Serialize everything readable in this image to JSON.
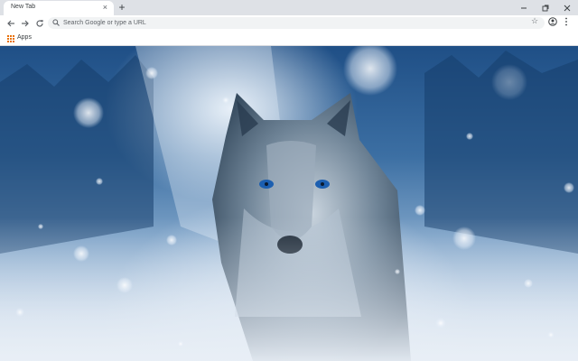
{
  "tab": {
    "title": "New Tab",
    "close_glyph": "×"
  },
  "new_tab_glyph": "+",
  "window_controls": {
    "minimize_glyph": "–",
    "restore_glyph": "❐",
    "close_glyph": "✕"
  },
  "toolbar": {
    "omnibox_placeholder": "Search Google or type a URL",
    "star_glyph": "☆"
  },
  "bookmarks": {
    "apps_label": "Apps"
  },
  "colors": {
    "tabstrip": "#dee1e6",
    "toolbar": "#ffffff",
    "omnibox": "#f1f3f4",
    "icon": "#5f6368",
    "text": "#3c4043"
  },
  "icons": [
    "back-arrow-icon",
    "forward-arrow-icon",
    "reload-icon",
    "search-icon",
    "star-icon",
    "profile-icon",
    "menu-icon",
    "apps-grid-icon"
  ]
}
